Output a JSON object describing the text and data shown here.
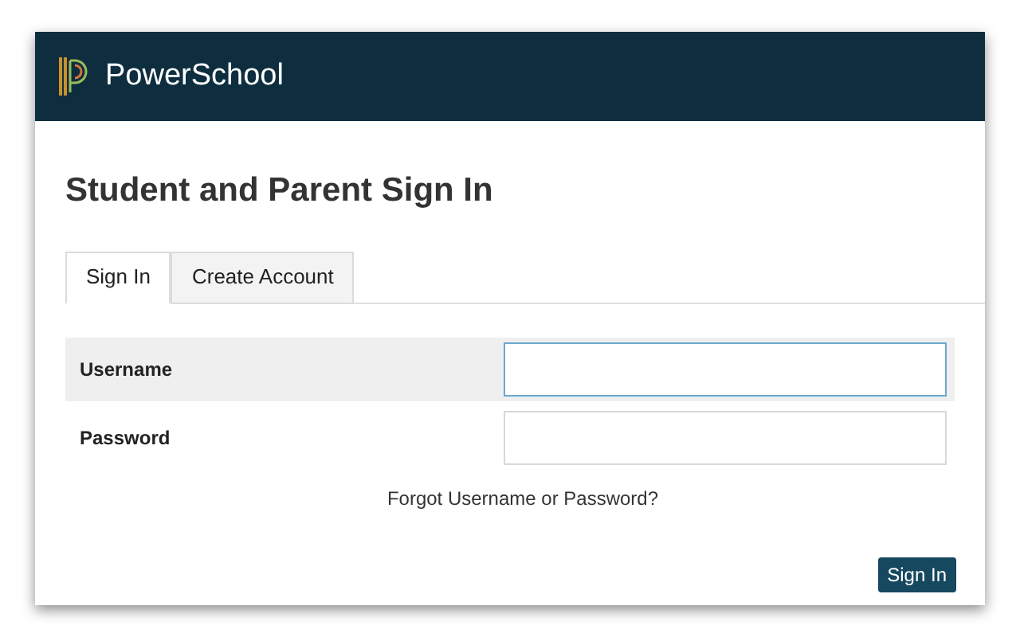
{
  "header": {
    "brand": "PowerSchool"
  },
  "title": "Student and Parent Sign In",
  "tabs": [
    {
      "label": "Sign In",
      "selected": true
    },
    {
      "label": "Create Account",
      "selected": false
    }
  ],
  "fields": [
    {
      "label": "Username",
      "focused": true
    },
    {
      "label": "Password",
      "focused": false
    }
  ],
  "forgot_link": "Forgot Username or Password?",
  "submit": "Sign In"
}
